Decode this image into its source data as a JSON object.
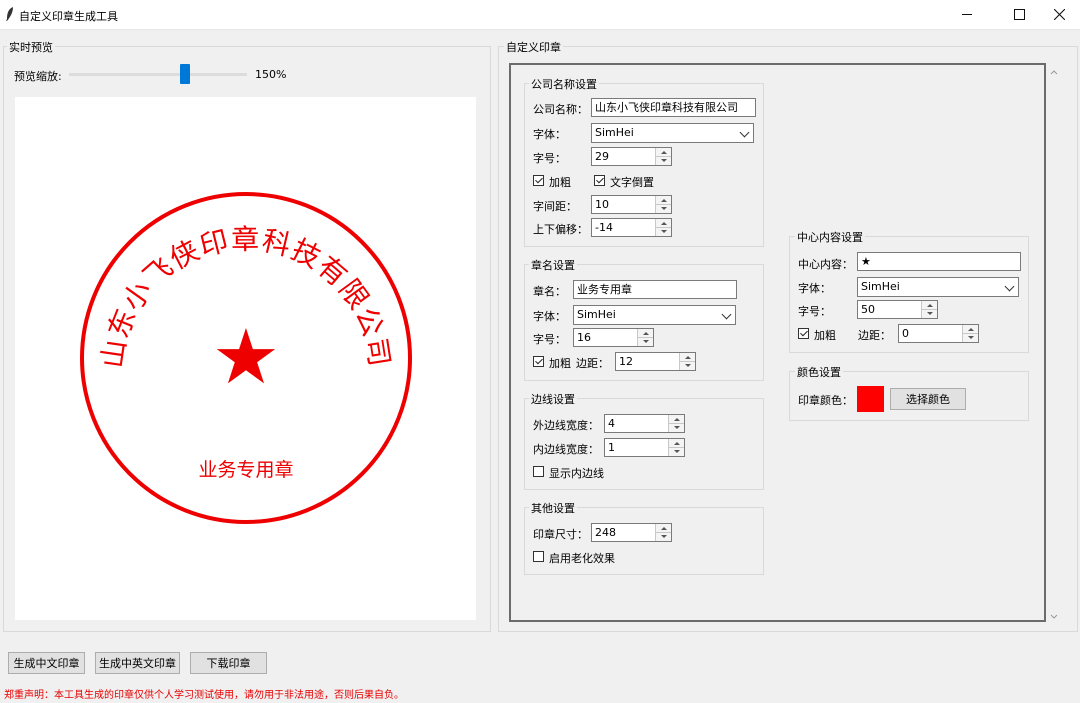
{
  "window": {
    "title": "自定义印章生成工具"
  },
  "preview": {
    "group_title": "实时预览",
    "zoom_label": "预览缩放:",
    "zoom_value": "150%",
    "zoom_fraction": 0.65
  },
  "seal": {
    "company_text": "山东小飞侠印章科技有限公司",
    "center_symbol": "★",
    "seal_name": "业务专用章",
    "color": "#ee0000"
  },
  "settings": {
    "group_title": "自定义印章",
    "company": {
      "title": "公司名称设置",
      "name_label": "公司名称：",
      "name_value": "山东小飞侠印章科技有限公司",
      "font_label": "字体：",
      "font_value": "SimHei",
      "size_label": "字号：",
      "size_value": "29",
      "bold_label": "加粗",
      "invert_label": "文字倒置",
      "spacing_label": "字间距：",
      "spacing_value": "10",
      "offset_label": "上下偏移：",
      "offset_value": "-14"
    },
    "seal_name": {
      "title": "章名设置",
      "name_label": "章名：",
      "name_value": "业务专用章",
      "font_label": "字体：",
      "font_value": "SimHei",
      "size_label": "字号：",
      "size_value": "16",
      "bold_label": "加粗",
      "margin_label": "边距：",
      "margin_value": "12"
    },
    "border": {
      "title": "边线设置",
      "outer_label": "外边线宽度：",
      "outer_value": "4",
      "inner_label": "内边线宽度：",
      "inner_value": "1",
      "show_inner_label": "显示内边线"
    },
    "other": {
      "title": "其他设置",
      "size_label": "印章尺寸：",
      "size_value": "248",
      "aging_label": "启用老化效果"
    },
    "center": {
      "title": "中心内容设置",
      "content_label": "中心内容：",
      "content_value": "★",
      "font_label": "字体：",
      "font_value": "SimHei",
      "size_label": "字号：",
      "size_value": "50",
      "bold_label": "加粗",
      "margin_label": "边距：",
      "margin_value": "0"
    },
    "color": {
      "title": "颜色设置",
      "label": "印章颜色：",
      "swatch": "#ff0000",
      "button": "选择颜色"
    }
  },
  "actions": {
    "gen_cn": "生成中文印章",
    "gen_cn_en": "生成中英文印章",
    "download": "下载印章"
  },
  "disclaimer": "郑重声明：本工具生成的印章仅供个人学习测试使用，请勿用于非法用途，否则后果自负。"
}
